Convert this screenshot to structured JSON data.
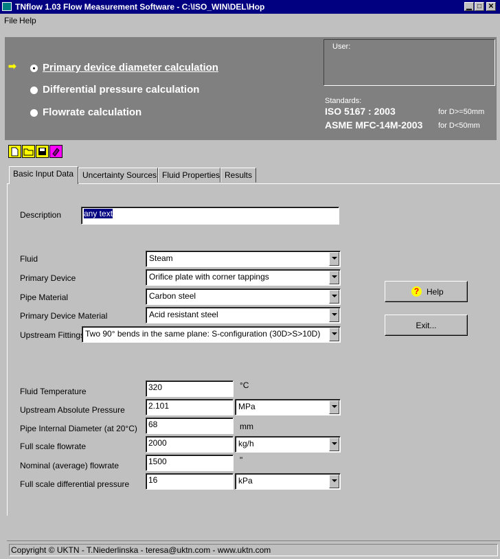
{
  "titlebar": {
    "title": "TNflow 1.03 Flow Measurement Software - C:\\ISO_WIN\\DEL\\Hop",
    "minimize": "▁",
    "maximize": "□",
    "close": "✕"
  },
  "menu": {
    "file": "File",
    "help": "Help"
  },
  "calc_options": [
    {
      "label": "Primary device diameter calculation",
      "selected": true
    },
    {
      "label": "Differential pressure calculation",
      "selected": false
    },
    {
      "label": "Flowrate calculation",
      "selected": false
    }
  ],
  "user_label": "User:",
  "standards": {
    "label": "Standards:",
    "iso": "ISO 5167 : 2003",
    "iso_note": "for D>=50mm",
    "asme": "ASME  MFC-14M-2003",
    "asme_note": "for D<50mm"
  },
  "toolbar": {
    "icons": [
      "new-file-icon",
      "open-folder-icon",
      "save-disk-icon",
      "book-icon"
    ]
  },
  "tabs": [
    "Basic Input Data",
    "Uncertainty Sources",
    "Fluid Properties",
    "Results"
  ],
  "form": {
    "description_label": "Description",
    "description_value": "any text",
    "fluid_label": "Fluid",
    "fluid_value": "Steam",
    "primary_device_label": "Primary Device",
    "primary_device_value": "Orifice plate with corner tappings",
    "pipe_material_label": "Pipe Material",
    "pipe_material_value": "Carbon steel",
    "pd_material_label": "Primary Device Material",
    "pd_material_value": "Acid resistant steel",
    "upstream_label": "Upstream Fittings",
    "upstream_value": "Two 90° bends in the same plane: S-configuration (30D>S>10D)",
    "temp_label": "Fluid Temperature",
    "temp_value": "320",
    "temp_unit": "°C",
    "pressure_label": "Upstream Absolute Pressure",
    "pressure_value": "2.101",
    "pressure_unit": "MPa",
    "diameter_label": "Pipe Internal Diameter (at 20°C)",
    "diameter_value": "68",
    "diameter_unit": "mm",
    "fullscale_label": "Full scale flowrate",
    "fullscale_value": "2000",
    "fullscale_unit": "kg/h",
    "nominal_label": "Nominal (average) flowrate",
    "nominal_value": "1500",
    "nominal_unit": "\"",
    "dp_label": "Full scale differential pressure",
    "dp_value": "16",
    "dp_unit": "kPa"
  },
  "buttons": {
    "help": "Help",
    "exit": "Exit..."
  },
  "status": "Copyright © UKTN - T.Niederlinska - teresa@uktn.com - www.uktn.com"
}
